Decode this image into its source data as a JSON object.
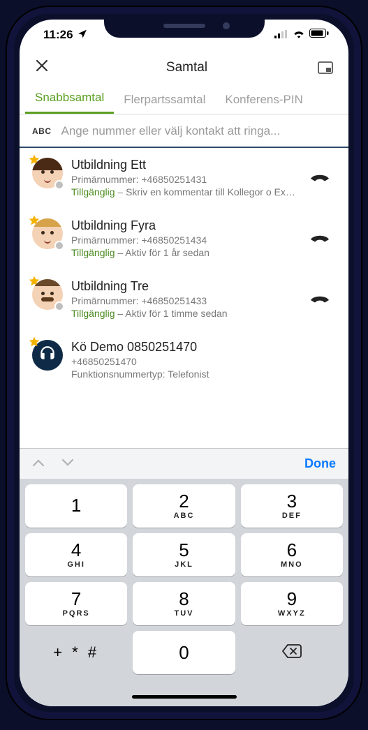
{
  "status": {
    "time": "11:26",
    "loc_icon": "location-arrow"
  },
  "nav": {
    "title": "Samtal"
  },
  "tabs": [
    {
      "label": "Snabbsamtal",
      "active": true
    },
    {
      "label": "Flerpartssamtal",
      "active": false
    },
    {
      "label": "Konferens-PIN",
      "active": false
    }
  ],
  "search": {
    "abc": "ABC",
    "placeholder": "Ange nummer eller välj kontakt att ringa..."
  },
  "contacts": [
    {
      "name": "Utbildning Ett",
      "primary_label": "Primärnummer: +46850251431",
      "status_word": "Tillgänglig",
      "status_rest": " – Skriv en kommentar till Kollegor o Ex…",
      "avatar": "female-brown",
      "callable": true
    },
    {
      "name": "Utbildning Fyra",
      "primary_label": "Primärnummer: +46850251434",
      "status_word": "Tillgänglig",
      "status_rest": " – Aktiv för 1 år sedan",
      "avatar": "male-blond",
      "callable": true
    },
    {
      "name": "Utbildning Tre",
      "primary_label": "Primärnummer: +46850251433",
      "status_word": "Tillgänglig",
      "status_rest": " – Aktiv för 1 timme sedan",
      "avatar": "male-mustache",
      "callable": true
    },
    {
      "name": "Kö Demo 0850251470",
      "primary_label": "+46850251470",
      "status_word": "",
      "status_rest": "Funktionsnummertyp: Telefonist",
      "avatar": "queue",
      "callable": false
    }
  ],
  "keyboard": {
    "done": "Done",
    "keys": [
      [
        {
          "d": "1",
          "l": ""
        },
        {
          "d": "2",
          "l": "ABC"
        },
        {
          "d": "3",
          "l": "DEF"
        }
      ],
      [
        {
          "d": "4",
          "l": "GHI"
        },
        {
          "d": "5",
          "l": "JKL"
        },
        {
          "d": "6",
          "l": "MNO"
        }
      ],
      [
        {
          "d": "7",
          "l": "PQRS"
        },
        {
          "d": "8",
          "l": "TUV"
        },
        {
          "d": "9",
          "l": "WXYZ"
        }
      ]
    ],
    "symbols": "+ * #",
    "zero": "0"
  }
}
